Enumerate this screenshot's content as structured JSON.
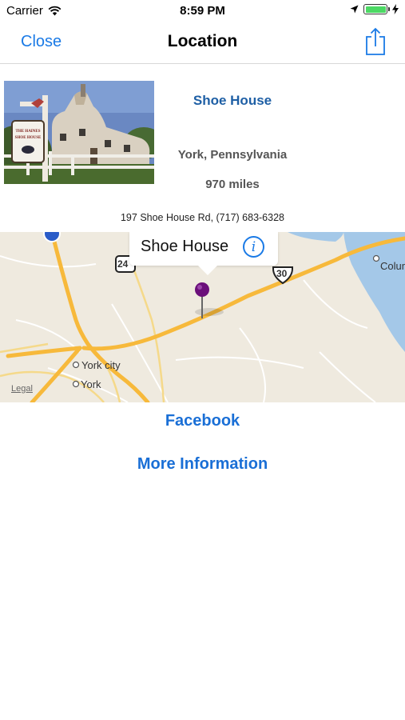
{
  "status_bar": {
    "carrier": "Carrier",
    "time": "8:59 PM",
    "battery_level": 1.0
  },
  "nav": {
    "close_label": "Close",
    "title": "Location",
    "share_icon": "share-icon"
  },
  "place": {
    "name": "Shoe House",
    "city": "York, Pennsylvania",
    "distance": "970 miles",
    "address": "197 Shoe House Rd, (717) 683-6328",
    "sign_text_1": "THE HAINES",
    "sign_text_2": "SHOE HOUSE"
  },
  "map": {
    "callout_title": "Shoe House",
    "callout_info_glyph": "i",
    "labels": {
      "york_city": "York city",
      "york": "York",
      "columbia": "Colum",
      "route_30": "30",
      "route_24": "24"
    },
    "legal": "Legal",
    "pin_color": "#6b0f7a"
  },
  "links": {
    "facebook": "Facebook",
    "more_information": "More Information"
  },
  "colors": {
    "accent": "#1a7ae6",
    "name": "#1e5fa5"
  }
}
